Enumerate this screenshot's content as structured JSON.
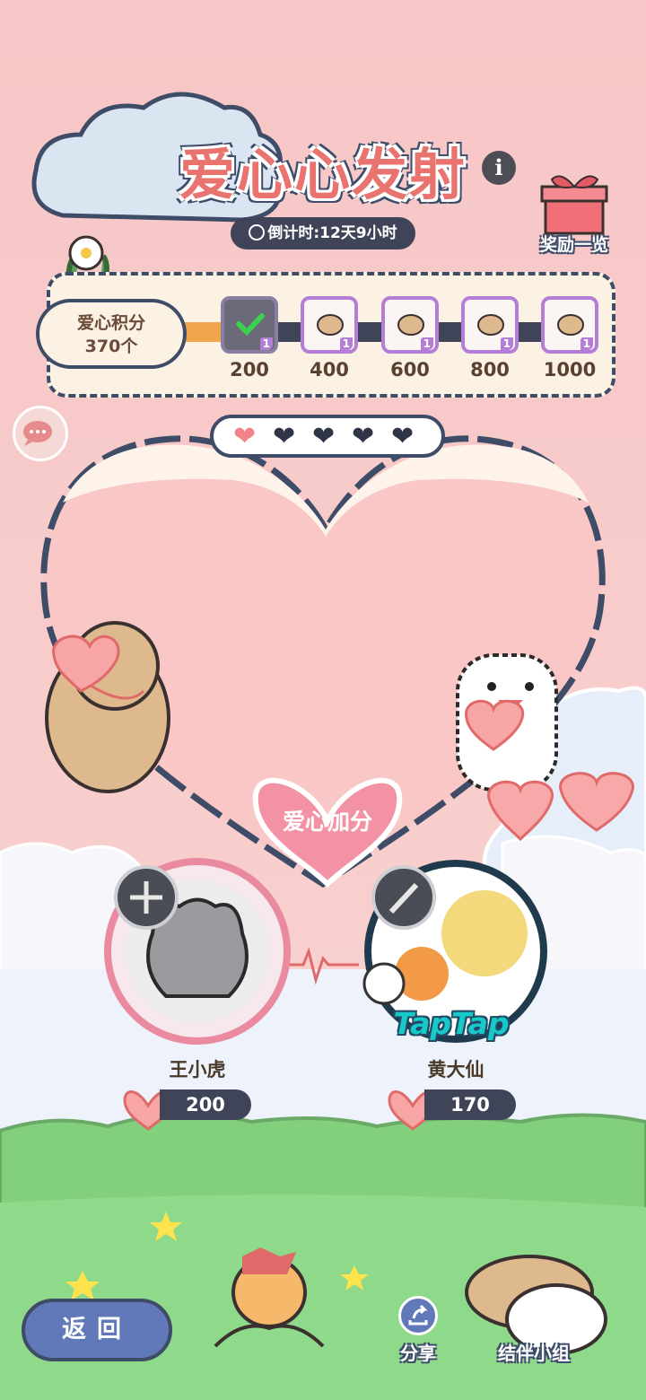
{
  "colors": {
    "background": "#f6c9c8",
    "title": "#e8736f",
    "outline": "#3f4c68",
    "progress_fill": "#f0a64a",
    "heart_pink": "#f3838a",
    "grass": "#7fce7a",
    "back_button": "#6179b8"
  },
  "event": {
    "title": "爱心心发射",
    "info_icon": "i",
    "countdown": "倒计时:12天9小时",
    "rewards_label": "奖励一览"
  },
  "score": {
    "label": "爱心积分",
    "value": "370个",
    "progress_fraction": 0.13
  },
  "tiers": [
    {
      "threshold": "200",
      "count": "1",
      "claimed": true,
      "icon": "claimed-check-icon"
    },
    {
      "threshold": "400",
      "count": "1",
      "claimed": false,
      "icon": "dog-face-sticker-icon"
    },
    {
      "threshold": "600",
      "count": "1",
      "claimed": false,
      "icon": "dog-lying-sticker-icon"
    },
    {
      "threshold": "800",
      "count": "1",
      "claimed": false,
      "icon": "dog-plush-sticker-icon"
    },
    {
      "threshold": "1000",
      "count": "1",
      "claimed": false,
      "icon": "dog-pair-sticker-icon"
    }
  ],
  "hearts_filled": 1,
  "hearts_total": 5,
  "bonus_button": "爱心加分",
  "players": [
    {
      "name": "王小虎",
      "score": "200",
      "class_icon": "cross-shield-icon"
    },
    {
      "name": "黄大仙",
      "score": "170",
      "class_icon": "sword-icon",
      "badge": "TapTap"
    }
  ],
  "bottom": {
    "back_label": "返回",
    "share_label": "分享",
    "group_label": "结伴小组"
  }
}
